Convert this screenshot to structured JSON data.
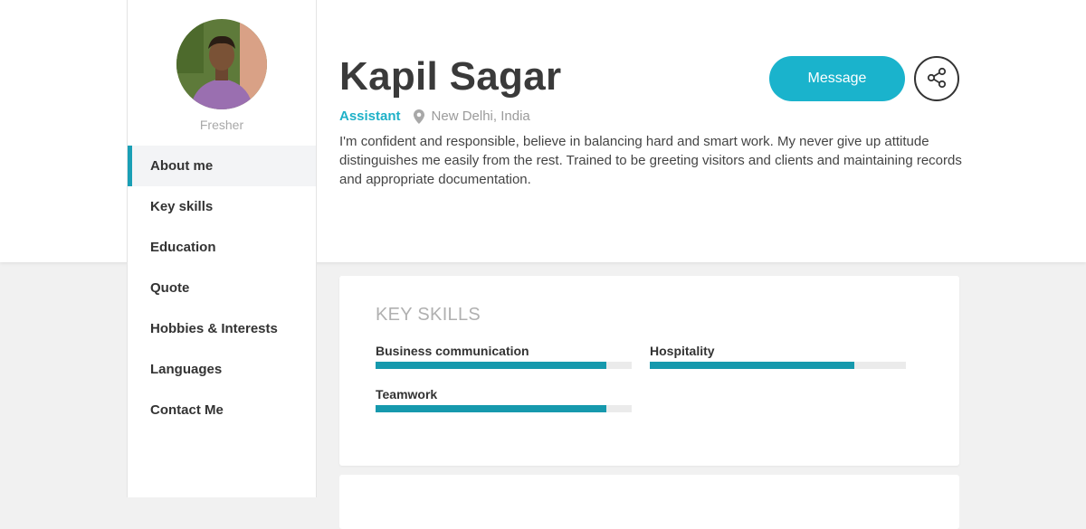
{
  "profile": {
    "name": "Kapil Sagar",
    "status": "Fresher",
    "role": "Assistant",
    "location": "New Delhi, India",
    "bio": "I'm confident and responsible, believe in balancing hard and smart work. My never give up attitude distinguishes me easily from the rest. Trained to be greeting visitors and clients and maintaining records and appropriate documentation."
  },
  "actions": {
    "message_label": "Message",
    "share_icon": "share-icon"
  },
  "sidebar": {
    "items": [
      {
        "label": "About me",
        "active": true
      },
      {
        "label": "Key skills"
      },
      {
        "label": "Education"
      },
      {
        "label": "Quote"
      },
      {
        "label": "Hobbies & Interests"
      },
      {
        "label": "Languages"
      },
      {
        "label": "Contact Me"
      }
    ]
  },
  "key_skills": {
    "title": "KEY SKILLS",
    "skills": [
      {
        "name": "Business communication",
        "level": 0.9
      },
      {
        "name": "Hospitality",
        "level": 0.8
      },
      {
        "name": "Teamwork",
        "level": 0.9
      }
    ]
  },
  "colors": {
    "accent": "#1ab3cc",
    "bar": "#1699ad",
    "role": "#1fb1c8"
  }
}
